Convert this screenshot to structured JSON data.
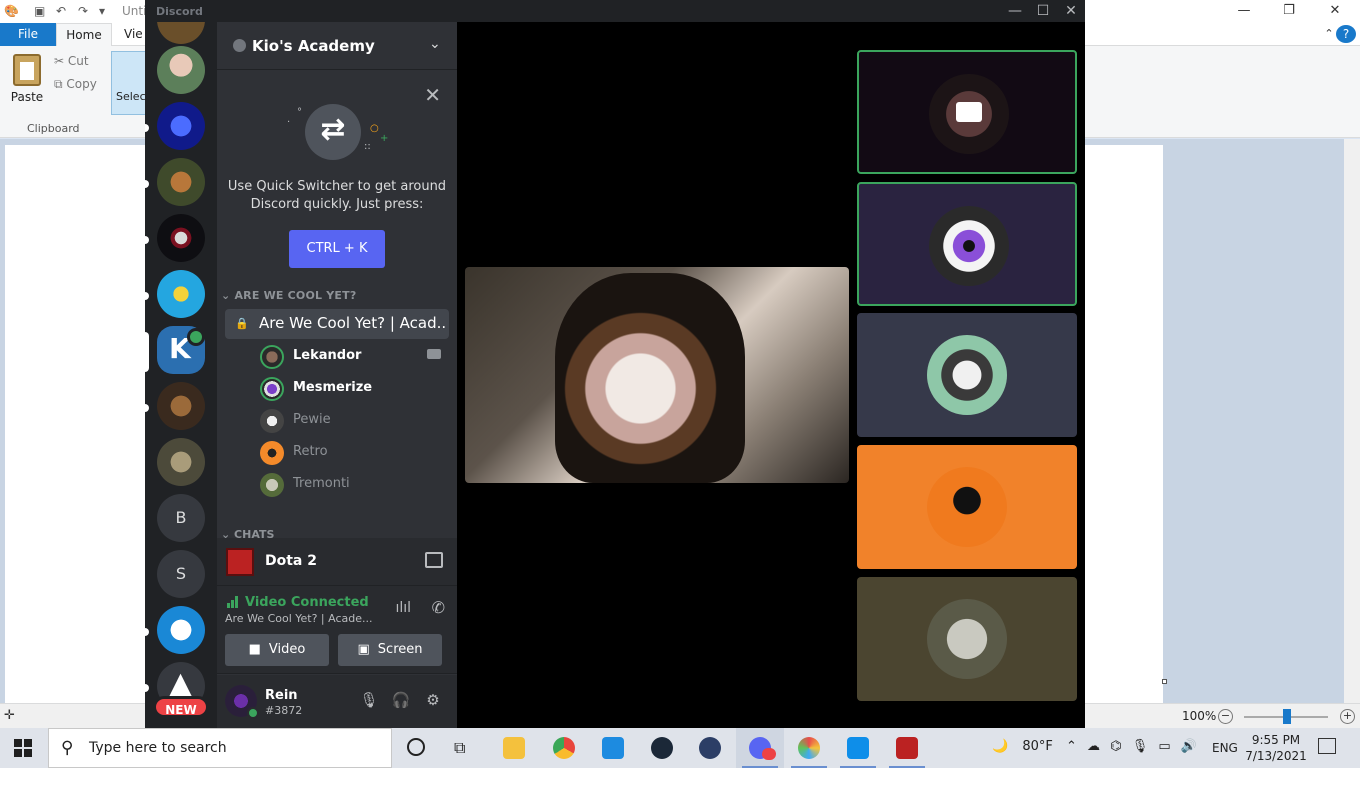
{
  "paint": {
    "title": "Unti",
    "tabs": {
      "file": "File",
      "home": "Home",
      "view": "Vie"
    },
    "clipboard": {
      "paste": "Paste",
      "cut": "Cut",
      "copy": "Copy",
      "group_label": "Clipboard"
    },
    "select": "Select",
    "zoom": "100%"
  },
  "discord": {
    "window_title": "Discord",
    "server": {
      "name": "Kio's Academy"
    },
    "quick_switcher": {
      "text": "Use Quick Switcher to get around Discord quickly. Just press:",
      "shortcut": "CTRL + K"
    },
    "category": "ARE WE COOL YET?",
    "voice_channel": "Are We Cool Yet? | Acad...",
    "members": [
      {
        "name": "Lekandor",
        "active": true
      },
      {
        "name": "Mesmerize",
        "active": true
      },
      {
        "name": "Pewie",
        "active": false
      },
      {
        "name": "Retro",
        "active": false
      },
      {
        "name": "Tremonti",
        "active": false
      }
    ],
    "chats_category": "CHATS",
    "guilds": {
      "letter_b": "B",
      "letter_s": "S",
      "new_badge": "NEW"
    },
    "activity": {
      "name": "Dota 2"
    },
    "rtc": {
      "status": "Video Connected",
      "channel": "Are We Cool Yet? | Acade...",
      "video_label": "Video",
      "screen_label": "Screen"
    },
    "user": {
      "name": "Rein",
      "tag": "#3872"
    },
    "colors": {
      "connected": "#3ba55d",
      "blurple": "#5865f2",
      "new_badge": "#ed4245"
    }
  },
  "taskbar": {
    "search_placeholder": "Type here to search",
    "weather": "80°F",
    "language": "ENG",
    "time": "9:55 PM",
    "date": "7/13/2021"
  }
}
